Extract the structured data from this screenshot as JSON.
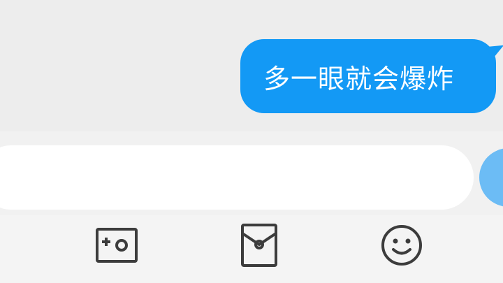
{
  "conversation": {
    "messages": [
      {
        "sender": "self",
        "text": "多一眼就会爆炸"
      }
    ]
  },
  "composer": {
    "input_value": "",
    "send_icon": "send-icon"
  },
  "toolbar": {
    "items": [
      {
        "icon": "photo-icon"
      },
      {
        "icon": "red-envelope-icon"
      },
      {
        "icon": "emoji-icon"
      }
    ]
  },
  "colors": {
    "bubble": "#1399f5",
    "send_button": "#6cbcf5",
    "background": "#efefef"
  }
}
